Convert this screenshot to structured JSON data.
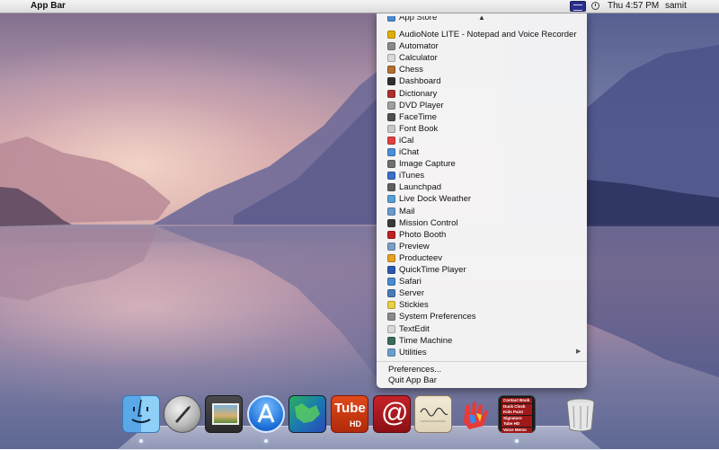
{
  "menubar": {
    "apple_symbol": "",
    "app_name": "App Bar",
    "clock": "Thu 4:57 PM",
    "user": "samit",
    "status_icons": [
      "app-bar-icon",
      "time-machine-icon"
    ]
  },
  "menu": {
    "scroll_indicator": "▲",
    "clipped_item": "App Store",
    "items": [
      {
        "label": "AudioNote LITE - Notepad and Voice Recorder",
        "icon_color": "#e0b000"
      },
      {
        "label": "Automator",
        "icon_color": "#8a8a8a"
      },
      {
        "label": "Calculator",
        "icon_color": "#d8d8d8"
      },
      {
        "label": "Chess",
        "icon_color": "#b07030"
      },
      {
        "label": "Dashboard",
        "icon_color": "#303030"
      },
      {
        "label": "Dictionary",
        "icon_color": "#b03030"
      },
      {
        "label": "DVD Player",
        "icon_color": "#a0a0a0"
      },
      {
        "label": "FaceTime",
        "icon_color": "#505050"
      },
      {
        "label": "Font Book",
        "icon_color": "#c8c8c8"
      },
      {
        "label": "iCal",
        "icon_color": "#e04040"
      },
      {
        "label": "iChat",
        "icon_color": "#4a90d8"
      },
      {
        "label": "Image Capture",
        "icon_color": "#707070"
      },
      {
        "label": "iTunes",
        "icon_color": "#3a6fc8"
      },
      {
        "label": "Launchpad",
        "icon_color": "#606060"
      },
      {
        "label": "Live Dock Weather",
        "icon_color": "#5aa0d8"
      },
      {
        "label": "Mail",
        "icon_color": "#6a9ad0"
      },
      {
        "label": "Mission Control",
        "icon_color": "#3a3a3a"
      },
      {
        "label": "Photo Booth",
        "icon_color": "#c02020"
      },
      {
        "label": "Preview",
        "icon_color": "#7aa0c8"
      },
      {
        "label": "Producteev",
        "icon_color": "#e8a020"
      },
      {
        "label": "QuickTime Player",
        "icon_color": "#2a5ab0"
      },
      {
        "label": "Safari",
        "icon_color": "#4a8ad0"
      },
      {
        "label": "Server",
        "icon_color": "#4a7ab8"
      },
      {
        "label": "Stickies",
        "icon_color": "#e8d040"
      },
      {
        "label": "System Preferences",
        "icon_color": "#8a8a8a"
      },
      {
        "label": "TextEdit",
        "icon_color": "#d8d8d8"
      },
      {
        "label": "Time Machine",
        "icon_color": "#3a6a5a"
      },
      {
        "label": "Utilities",
        "icon_color": "#6aa0d0",
        "has_submenu": true
      }
    ],
    "submenu_arrow": "▶",
    "preferences_label": "Preferences...",
    "quit_label": "Quit App Bar"
  },
  "dock": {
    "apps": [
      {
        "name": "finder-icon",
        "running": true
      },
      {
        "name": "launchpad-icon",
        "running": false
      },
      {
        "name": "photo-app-icon",
        "running": false
      },
      {
        "name": "app-store-icon",
        "running": true
      },
      {
        "name": "live-dock-weather-icon",
        "running": false
      },
      {
        "name": "tube-hd-icon",
        "running": false
      },
      {
        "name": "mail-at-icon",
        "running": false
      },
      {
        "name": "signature-icon",
        "running": false
      },
      {
        "name": "kids-paint-icon",
        "running": false
      },
      {
        "name": "app-bundle-icon",
        "running": true
      },
      {
        "name": "trash-icon",
        "running": false
      }
    ],
    "tube_label": "Tube",
    "tube_sub": "HD",
    "bundle_items": [
      "Contact Book",
      "Duck Clock",
      "Kids Paint",
      "Signature",
      "Tube HD",
      "Voice Memo"
    ]
  }
}
